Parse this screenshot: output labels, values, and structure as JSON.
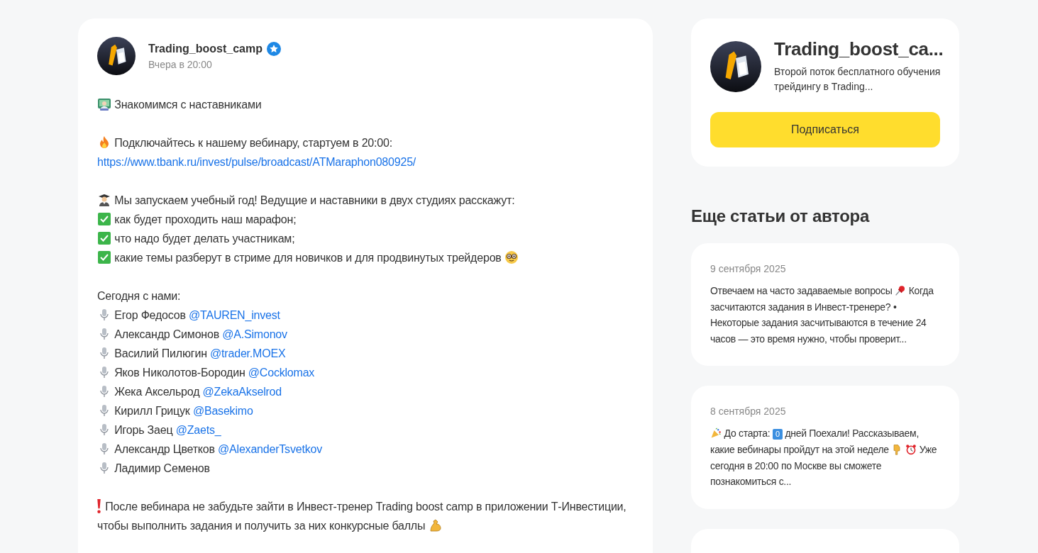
{
  "post": {
    "author": "Trading_boost_camp",
    "verified": true,
    "time": "Вчера в 20:00",
    "paragraphs": [
      {
        "lines": [
          {
            "parts": [
              {
                "kind": "technologist"
              },
              {
                "kind": "text",
                "text": "Знакомимся с наставниками"
              }
            ]
          }
        ]
      },
      {
        "lines": [
          {
            "parts": [
              {
                "kind": "fire"
              },
              {
                "kind": "text",
                "text": "Подключайтесь к нашему вебинару, стартуем в 20:00:"
              }
            ]
          },
          {
            "parts": [
              {
                "kind": "link",
                "text": "https://www.tbank.ru/invest/pulse/broadcast/ATMaraphon080925/"
              }
            ]
          }
        ]
      },
      {
        "lines": [
          {
            "parts": [
              {
                "kind": "graduate"
              },
              {
                "kind": "text",
                "text": "Мы запускаем учебный год! Ведущие и наставники в двух студиях расскажут:"
              }
            ]
          },
          {
            "parts": [
              {
                "kind": "check"
              },
              {
                "kind": "text",
                "text": "как будет проходить наш марафон;"
              }
            ]
          },
          {
            "parts": [
              {
                "kind": "check"
              },
              {
                "kind": "text",
                "text": "что надо будет делать участникам;"
              }
            ]
          },
          {
            "parts": [
              {
                "kind": "check"
              },
              {
                "kind": "text",
                "text": "какие темы разберут в стриме для новичков и для продвинутых трейдеров"
              },
              {
                "kind": "nerd"
              }
            ]
          }
        ]
      },
      {
        "lines": [
          {
            "parts": [
              {
                "kind": "text",
                "text": "Сегодня с нами:"
              }
            ]
          },
          {
            "parts": [
              {
                "kind": "mic"
              },
              {
                "kind": "text",
                "text": "Егор Федосов"
              },
              {
                "kind": "link",
                "text": "@TAUREN_invest"
              }
            ]
          },
          {
            "parts": [
              {
                "kind": "mic"
              },
              {
                "kind": "text",
                "text": "Александр Симонов"
              },
              {
                "kind": "link",
                "text": "@A.Simonov"
              }
            ]
          },
          {
            "parts": [
              {
                "kind": "mic"
              },
              {
                "kind": "text",
                "text": "Василий Пилюгин"
              },
              {
                "kind": "link",
                "text": "@trader.MOEX"
              }
            ]
          },
          {
            "parts": [
              {
                "kind": "mic"
              },
              {
                "kind": "text",
                "text": "Яков Николотов-Бородин"
              },
              {
                "kind": "link",
                "text": "@Cocklomax"
              }
            ]
          },
          {
            "parts": [
              {
                "kind": "mic"
              },
              {
                "kind": "text",
                "text": "Жека Аксельрод"
              },
              {
                "kind": "link",
                "text": "@ZekaAkselrod"
              }
            ]
          },
          {
            "parts": [
              {
                "kind": "mic"
              },
              {
                "kind": "text",
                "text": "Кирилл Грицук"
              },
              {
                "kind": "link",
                "text": "@Basekimo"
              }
            ]
          },
          {
            "parts": [
              {
                "kind": "mic"
              },
              {
                "kind": "text",
                "text": "Игорь Заец"
              },
              {
                "kind": "link",
                "text": "@Zaets_"
              }
            ]
          },
          {
            "parts": [
              {
                "kind": "mic"
              },
              {
                "kind": "text",
                "text": "Александр Цветков"
              },
              {
                "kind": "link",
                "text": "@AlexanderTsvetkov"
              }
            ]
          },
          {
            "parts": [
              {
                "kind": "mic"
              },
              {
                "kind": "text",
                "text": "Ладимир Семенов"
              }
            ]
          }
        ]
      },
      {
        "lines": [
          {
            "parts": [
              {
                "kind": "exclaim"
              },
              {
                "kind": "text",
                "text": "После вебинара не забудьте зайти в Инвест-тренер Trading boost camp в приложении Т-Инвестиции, чтобы выполнить задания и получить за них конкурсные баллы"
              },
              {
                "kind": "muscle"
              }
            ]
          }
        ]
      }
    ]
  },
  "profile": {
    "title": "Trading_boost_ca...",
    "description": "Второй поток бесплатного обучения трейдингу в Trading...",
    "button": "Подписаться"
  },
  "more_articles": {
    "heading": "Еще статьи от автора",
    "items": [
      {
        "date": "9 сентября 2025",
        "parts": [
          {
            "kind": "text",
            "text": "Отвечаем на часто задаваемые вопросы"
          },
          {
            "kind": "pin"
          },
          {
            "kind": "text",
            "text": "Когда засчитаются задания в Инвест-тренере? • Некоторые задания засчитываются в течение 24 часов — это время нужно, чтобы проверит..."
          }
        ]
      },
      {
        "date": "8 сентября 2025",
        "parts": [
          {
            "kind": "party"
          },
          {
            "kind": "text",
            "text": "До старта:"
          },
          {
            "kind": "keycap",
            "text": "0"
          },
          {
            "kind": "text",
            "text": "дней Поехали! Рассказываем, какие вебинары пройдут на этой неделе"
          },
          {
            "kind": "pointer"
          },
          {
            "kind": "alarm"
          },
          {
            "kind": "text",
            "text": "Уже сегодня в 20:00 по Москве вы сможете познакомиться с..."
          }
        ]
      }
    ],
    "more_below": true
  }
}
